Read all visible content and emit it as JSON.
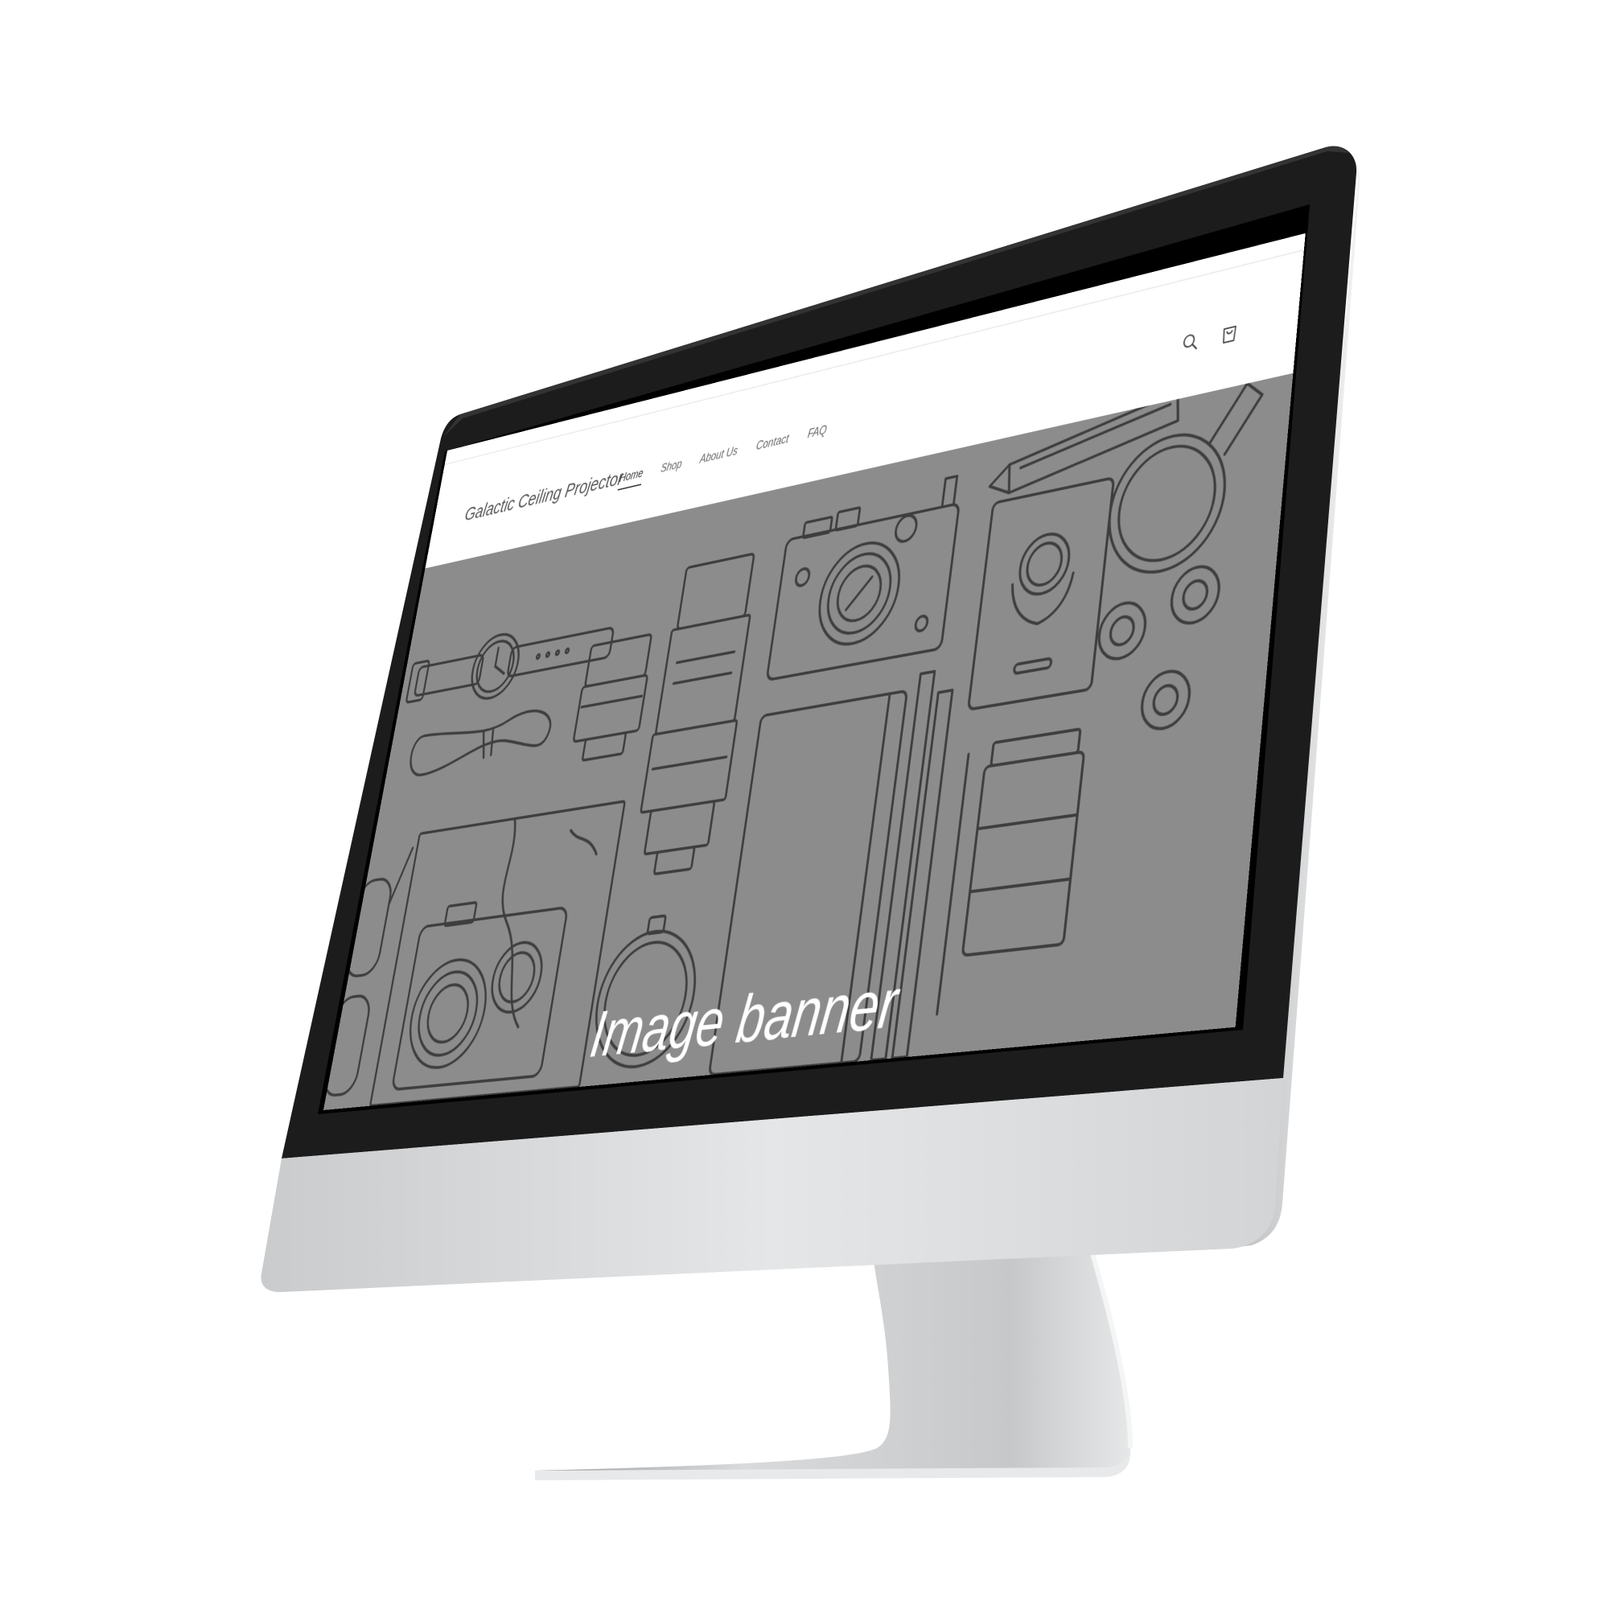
{
  "site": {
    "title": "Galactic Ceiling Projector",
    "nav": [
      {
        "label": "Home",
        "active": true
      },
      {
        "label": "Shop",
        "active": false
      },
      {
        "label": "About Us",
        "active": false
      },
      {
        "label": "Contact",
        "active": false
      },
      {
        "label": "FAQ",
        "active": false
      }
    ],
    "icons": [
      "search-icon",
      "cart-icon"
    ]
  },
  "banner": {
    "caption": "Image banner",
    "background_color": "#8c8c8c",
    "illustration": [
      "wristwatch",
      "cable",
      "lens",
      "zoom-lens",
      "camera",
      "notebook",
      "passport",
      "pencil",
      "magnifying-glass",
      "tape-rolls",
      "map",
      "twin-lens-camera",
      "glasses",
      "stopwatch",
      "bottle"
    ]
  },
  "device": {
    "bezel_color": "#1c1c1c",
    "chin_color": "#d9dbdc"
  }
}
